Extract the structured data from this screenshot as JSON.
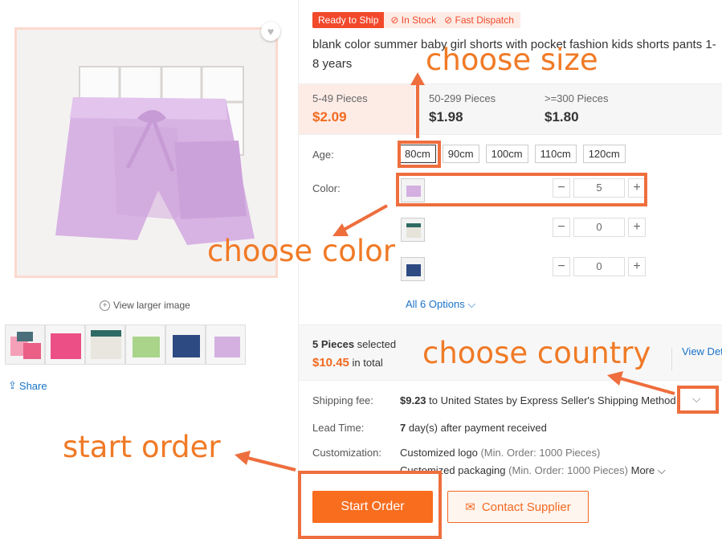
{
  "product": {
    "badges": {
      "ready": "Ready to Ship",
      "in_stock": "In Stock",
      "fast_dispatch": "Fast Dispatch"
    },
    "title": "blank color summer baby girl shorts with pocket fashion kids shorts pants 1-8 years",
    "view_larger": "View larger image",
    "share": "Share"
  },
  "price_tiers": [
    {
      "qty": "5-49 Pieces",
      "price": "$2.09"
    },
    {
      "qty": "50-299 Pieces",
      "price": "$1.98"
    },
    {
      "qty": ">=300 Pieces",
      "price": "$1.80"
    }
  ],
  "age": {
    "label": "Age:",
    "options": [
      "80cm",
      "90cm",
      "100cm",
      "110cm",
      "120cm"
    ],
    "selected": "80cm"
  },
  "color": {
    "label": "Color:",
    "rows": [
      {
        "swatch": "lavender-shorts",
        "qty": "5"
      },
      {
        "swatch": "white-green-shorts",
        "qty": "0"
      },
      {
        "swatch": "navy-denim-shorts",
        "qty": "0"
      }
    ],
    "all_options": "All 6 Options"
  },
  "summary": {
    "pieces": "5 Pieces",
    "selected_text": "selected",
    "total": "$10.45",
    "total_text": "in total",
    "view_details": "View Details"
  },
  "shipping": {
    "label": "Shipping fee:",
    "amount": "$9.23",
    "text": "to United States by Express Seller's Shipping Method"
  },
  "lead_time": {
    "label": "Lead Time:",
    "days": "7",
    "text": "day(s) after payment received"
  },
  "customization": {
    "label": "Customization:",
    "items": [
      {
        "name": "Customized logo",
        "min": "(Min. Order: 1000 Pieces)"
      },
      {
        "name": "Customized packaging",
        "min": "(Min. Order: 1000 Pieces)"
      }
    ],
    "more": "More"
  },
  "buttons": {
    "start_order": "Start Order",
    "contact_supplier": "Contact Supplier"
  },
  "annotations": {
    "choose_size": "choose size",
    "choose_color": "choose color",
    "choose_country": "choose country",
    "start_order": "start order"
  },
  "colors": {
    "accent": "#f96d1e",
    "annotation": "#ee6e3d",
    "link": "#1a73c9",
    "badge": "#f2492b"
  }
}
